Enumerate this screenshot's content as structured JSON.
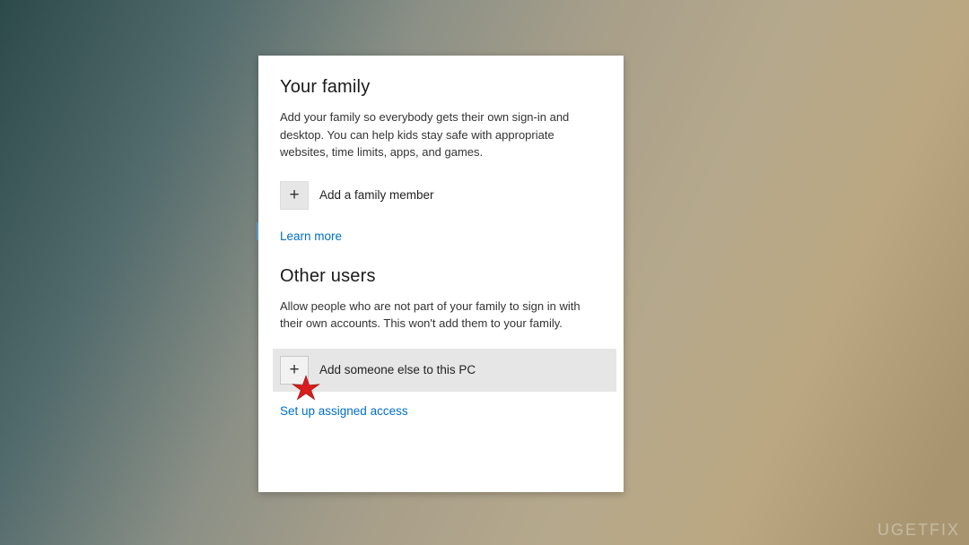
{
  "family": {
    "heading": "Your family",
    "description": "Add your family so everybody gets their own sign-in and desktop. You can help kids stay safe with appropriate websites, time limits, apps, and games.",
    "add_label": "Add a family member",
    "learn_more": "Learn more"
  },
  "other": {
    "heading": "Other users",
    "description": "Allow people who are not part of your family to sign in with their own accounts. This won't add them to your family.",
    "add_label": "Add someone else to this PC",
    "assigned_access": "Set up assigned access"
  },
  "watermark": "UGETFIX",
  "icons": {
    "plus": "+"
  }
}
